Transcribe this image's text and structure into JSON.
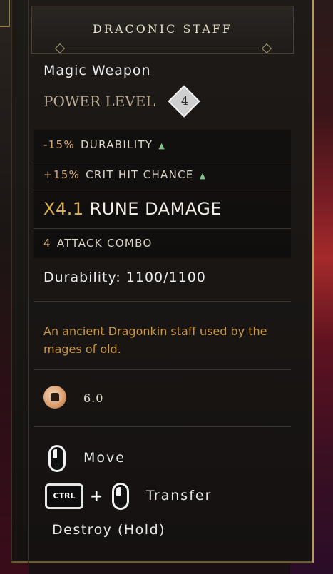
{
  "item": {
    "name": "DRACONIC STAFF",
    "type": "Magic Weapon",
    "power_level_label": "POWER LEVEL",
    "power_level": "4"
  },
  "perks": [
    {
      "value": "-15%",
      "label": "DURABILITY",
      "increased": true
    },
    {
      "value": "+15%",
      "label": "CRIT HIT CHANCE",
      "increased": true
    },
    {
      "value": "X4.1",
      "label": "RUNE DAMAGE"
    },
    {
      "value": "4",
      "label": "ATTACK COMBO"
    }
  ],
  "durability": "Durability: 1100/1100",
  "description": "An ancient Dragonkin staff used by the mages of old.",
  "weight": "6.0",
  "controls": {
    "move": "Move",
    "ctrl_key": "CTRL",
    "plus": "+",
    "transfer": "Transfer",
    "destroy": "Destroy (Hold)"
  },
  "colors": {
    "accent_gold": "#b89a55",
    "perk_value": "#d7a978",
    "description": "#c99a48",
    "increase_arrow": "#7ec48a"
  },
  "icons": [
    "triangle-up-icon",
    "weight-icon",
    "mouse-left-icon",
    "mouse-right-icon"
  ]
}
